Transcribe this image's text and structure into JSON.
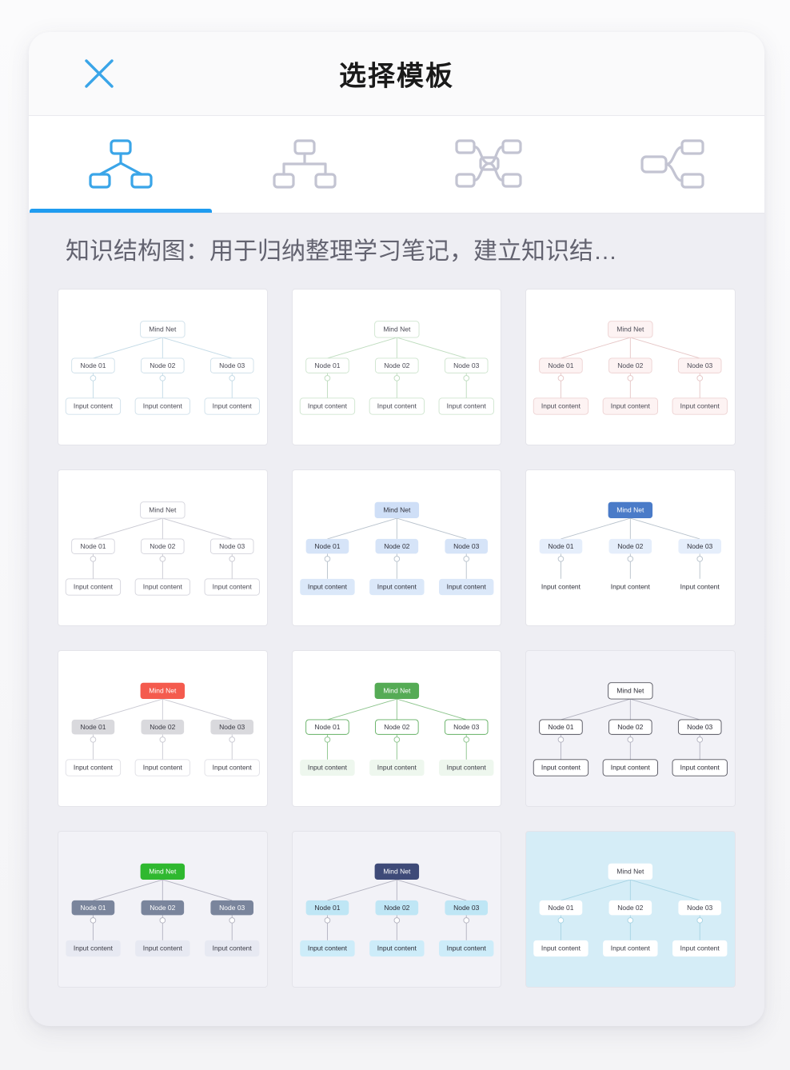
{
  "header": {
    "title": "选择模板",
    "close_label": "×"
  },
  "tabs": [
    {
      "icon": "tree-diagonal-icon",
      "name": "tab-tree-diagonal",
      "active": true
    },
    {
      "icon": "org-chart-icon",
      "name": "tab-org-chart",
      "active": false
    },
    {
      "icon": "mind-map-bidirectional-icon",
      "name": "tab-mind-map-bidirectional",
      "active": false
    },
    {
      "icon": "mind-map-right-icon",
      "name": "tab-mind-map-right",
      "active": false
    }
  ],
  "description": "知识结构图：用于归纳整理学习笔记，建立知识结…",
  "node_labels": {
    "root": "Mind Net",
    "children": [
      "Node 01",
      "Node 02",
      "Node 03"
    ],
    "leaf": "Input content"
  },
  "colors": {
    "accent": "#1f9cf0",
    "panel_bg": "#eeeef3",
    "header_bg": "#fafafb",
    "desc_text": "#636370",
    "tab_inactive": "#c3c4d2"
  },
  "templates": [
    {
      "id": "template-01",
      "name": "blue-outline",
      "card_bg": "#ffffff",
      "root": {
        "fill": "#ffffff",
        "stroke": "#cfe0ea",
        "text": "#4a4a55"
      },
      "child": {
        "fill": "#ffffff",
        "stroke": "#cfe0ea",
        "text": "#4a4a55"
      },
      "leaf": {
        "fill": "#ffffff",
        "stroke": "#cfe0ea",
        "text": "#4a4a55"
      },
      "line": "#c3dae6"
    },
    {
      "id": "template-02",
      "name": "green-outline",
      "card_bg": "#ffffff",
      "root": {
        "fill": "#ffffff",
        "stroke": "#cfe5cf",
        "text": "#4a4a55"
      },
      "child": {
        "fill": "#ffffff",
        "stroke": "#cfe5cf",
        "text": "#4a4a55"
      },
      "leaf": {
        "fill": "#ffffff",
        "stroke": "#cfe5cf",
        "text": "#4a4a55"
      },
      "line": "#bedcbe"
    },
    {
      "id": "template-03",
      "name": "pink-outline",
      "card_bg": "#ffffff",
      "root": {
        "fill": "#fdf3f3",
        "stroke": "#eed3d3",
        "text": "#4a4a55"
      },
      "child": {
        "fill": "#fdf3f3",
        "stroke": "#eed3d3",
        "text": "#4a4a55"
      },
      "leaf": {
        "fill": "#fdf3f3",
        "stroke": "#eed3d3",
        "text": "#4a4a55"
      },
      "line": "#e6c6c6"
    },
    {
      "id": "template-04",
      "name": "gray-outline",
      "card_bg": "#ffffff",
      "root": {
        "fill": "#ffffff",
        "stroke": "#d5d5dd",
        "text": "#4a4a55"
      },
      "child": {
        "fill": "#ffffff",
        "stroke": "#d5d5dd",
        "text": "#4a4a55"
      },
      "leaf": {
        "fill": "#ffffff",
        "stroke": "#d5d5dd",
        "text": "#4a4a55"
      },
      "line": "#c9c9d2"
    },
    {
      "id": "template-05",
      "name": "soft-blue-fill",
      "card_bg": "#ffffff",
      "root": {
        "fill": "#cfdff7",
        "stroke": "none",
        "text": "#32333d"
      },
      "child": {
        "fill": "#d6e4f8",
        "stroke": "none",
        "text": "#32333d"
      },
      "leaf": {
        "fill": "#dbe8f9",
        "stroke": "none",
        "text": "#32333d"
      },
      "line": "#b8c2cc"
    },
    {
      "id": "template-06",
      "name": "navy-root-blue",
      "card_bg": "#ffffff",
      "root": {
        "fill": "#4a7bc8",
        "stroke": "none",
        "text": "#ffffff"
      },
      "child": {
        "fill": "#e5eefb",
        "stroke": "none",
        "text": "#32333d"
      },
      "leaf": {
        "fill": "#ffffff",
        "stroke": "none",
        "text": "#32333d"
      },
      "line": "#b8c2cc"
    },
    {
      "id": "template-07",
      "name": "red-root-gray",
      "card_bg": "#ffffff",
      "root": {
        "fill": "#f45b4e",
        "stroke": "none",
        "text": "#ffffff"
      },
      "child": {
        "fill": "#d9d9dd",
        "stroke": "none",
        "text": "#3a3a44"
      },
      "leaf": {
        "fill": "#ffffff",
        "stroke": "#e0e0e6",
        "text": "#3a3a44"
      },
      "line": "#c9c9d2"
    },
    {
      "id": "template-08",
      "name": "green-root-outline",
      "card_bg": "#ffffff",
      "root": {
        "fill": "#55ab55",
        "stroke": "none",
        "text": "#ffffff"
      },
      "child": {
        "fill": "#ffffff",
        "stroke": "#63b063",
        "text": "#3a3a44"
      },
      "leaf": {
        "fill": "#eef7ee",
        "stroke": "none",
        "text": "#3a3a44"
      },
      "line": "#8cc48c"
    },
    {
      "id": "template-09",
      "name": "lavender-dark-outline",
      "card_bg": "#f2f2f7",
      "root": {
        "fill": "#ffffff",
        "stroke": "#55555f",
        "text": "#2c2c36"
      },
      "child": {
        "fill": "#ffffff",
        "stroke": "#55555f",
        "text": "#2c2c36"
      },
      "leaf": {
        "fill": "#ffffff",
        "stroke": "#55555f",
        "text": "#2c2c36"
      },
      "line": "#b3b3c0"
    },
    {
      "id": "template-10",
      "name": "green-root-slate",
      "card_bg": "#f2f2f7",
      "root": {
        "fill": "#2fb82f",
        "stroke": "none",
        "text": "#ffffff"
      },
      "child": {
        "fill": "#7a859c",
        "stroke": "none",
        "text": "#ffffff"
      },
      "leaf": {
        "fill": "#e7e9f2",
        "stroke": "none",
        "text": "#3a3a44"
      },
      "line": "#b3b3c0"
    },
    {
      "id": "template-11",
      "name": "navy-root-cyan",
      "card_bg": "#f2f2f7",
      "root": {
        "fill": "#3e4a78",
        "stroke": "none",
        "text": "#ffffff"
      },
      "child": {
        "fill": "#bfe6f5",
        "stroke": "none",
        "text": "#2c2c36"
      },
      "leaf": {
        "fill": "#cdecf9",
        "stroke": "none",
        "text": "#2c2c36"
      },
      "line": "#b3b3c0"
    },
    {
      "id": "template-12",
      "name": "cyan-bg-white-nodes",
      "card_bg": "#d5edf7",
      "root": {
        "fill": "#ffffff",
        "stroke": "none",
        "text": "#3a3a44"
      },
      "child": {
        "fill": "#ffffff",
        "stroke": "none",
        "text": "#3a3a44"
      },
      "leaf": {
        "fill": "#ffffff",
        "stroke": "none",
        "text": "#3a3a44"
      },
      "line": "#a8d4e4"
    }
  ]
}
